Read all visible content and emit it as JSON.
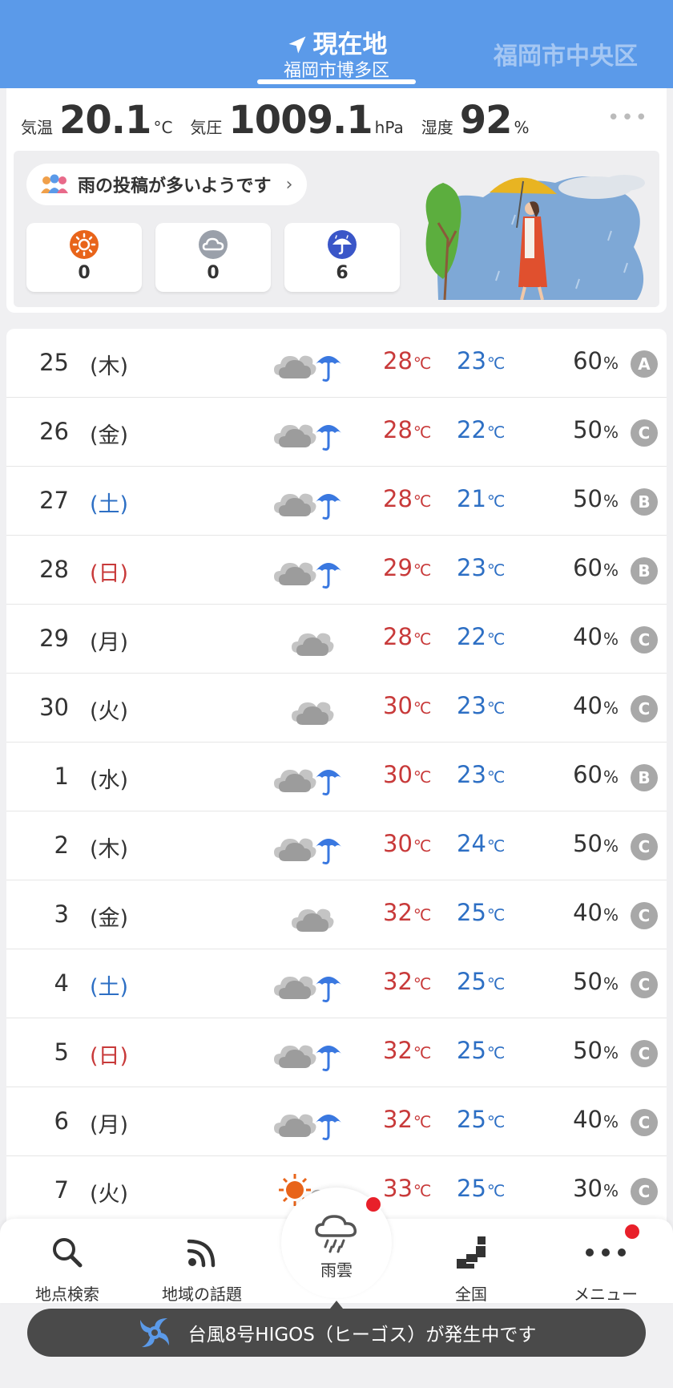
{
  "header": {
    "title": "現在地",
    "subtitle": "福岡市博多区",
    "alt_location": "福岡市中央区",
    "icon": "navigation-arrow-icon"
  },
  "current": {
    "temp_label": "気温",
    "temp_value": "20.1",
    "temp_unit": "°C",
    "pressure_label": "気圧",
    "pressure_value": "1009.1",
    "pressure_unit": "hPa",
    "humidity_label": "湿度",
    "humidity_value": "92",
    "humidity_unit": "%",
    "more": "•••"
  },
  "posts": {
    "message": "雨の投稿が多いようです",
    "chevron": "›",
    "counts": [
      {
        "icon": "sun-icon",
        "value": "0"
      },
      {
        "icon": "cloud-icon",
        "value": "0"
      },
      {
        "icon": "umbrella-icon",
        "value": "6"
      }
    ]
  },
  "forecast": [
    {
      "day": "25",
      "dow": "(木)",
      "dow_type": "weekday",
      "weather": "cloud-rain",
      "high": "28",
      "low": "23",
      "pop": "60",
      "reliability": "A"
    },
    {
      "day": "26",
      "dow": "(金)",
      "dow_type": "weekday",
      "weather": "cloud-rain",
      "high": "28",
      "low": "22",
      "pop": "50",
      "reliability": "C"
    },
    {
      "day": "27",
      "dow": "(土)",
      "dow_type": "sat",
      "weather": "cloud-rain",
      "high": "28",
      "low": "21",
      "pop": "50",
      "reliability": "B"
    },
    {
      "day": "28",
      "dow": "(日)",
      "dow_type": "sun",
      "weather": "cloud-rain",
      "high": "29",
      "low": "23",
      "pop": "60",
      "reliability": "B"
    },
    {
      "day": "29",
      "dow": "(月)",
      "dow_type": "weekday",
      "weather": "cloud",
      "high": "28",
      "low": "22",
      "pop": "40",
      "reliability": "C"
    },
    {
      "day": "30",
      "dow": "(火)",
      "dow_type": "weekday",
      "weather": "cloud",
      "high": "30",
      "low": "23",
      "pop": "40",
      "reliability": "C"
    },
    {
      "day": "1",
      "dow": "(水)",
      "dow_type": "weekday",
      "weather": "cloud-rain",
      "high": "30",
      "low": "23",
      "pop": "60",
      "reliability": "B"
    },
    {
      "day": "2",
      "dow": "(木)",
      "dow_type": "weekday",
      "weather": "cloud-rain",
      "high": "30",
      "low": "24",
      "pop": "50",
      "reliability": "C"
    },
    {
      "day": "3",
      "dow": "(金)",
      "dow_type": "weekday",
      "weather": "cloud",
      "high": "32",
      "low": "25",
      "pop": "40",
      "reliability": "C"
    },
    {
      "day": "4",
      "dow": "(土)",
      "dow_type": "sat",
      "weather": "cloud-rain",
      "high": "32",
      "low": "25",
      "pop": "50",
      "reliability": "C"
    },
    {
      "day": "5",
      "dow": "(日)",
      "dow_type": "sun",
      "weather": "cloud-rain",
      "high": "32",
      "low": "25",
      "pop": "50",
      "reliability": "C"
    },
    {
      "day": "6",
      "dow": "(月)",
      "dow_type": "weekday",
      "weather": "cloud-rain",
      "high": "32",
      "low": "25",
      "pop": "40",
      "reliability": "C"
    },
    {
      "day": "7",
      "dow": "(火)",
      "dow_type": "weekday",
      "weather": "sun-cloud",
      "high": "33",
      "low": "25",
      "pop": "30",
      "reliability": "C"
    }
  ],
  "units": {
    "temp": "℃",
    "pop": "%"
  },
  "nav": {
    "search": "地点検索",
    "topics": "地域の話題",
    "rain": "雨雲",
    "national": "全国",
    "menu": "メニュー"
  },
  "banner": {
    "text": "台風8号HIGOS（ヒーゴス）が発生中です",
    "icon": "typhoon-icon"
  },
  "colors": {
    "header": "#5b9ae9",
    "high_temp": "#c83a3a",
    "low_temp": "#2d6fc4",
    "umbrella": "#3a78e0",
    "badge": "#e8202a"
  }
}
